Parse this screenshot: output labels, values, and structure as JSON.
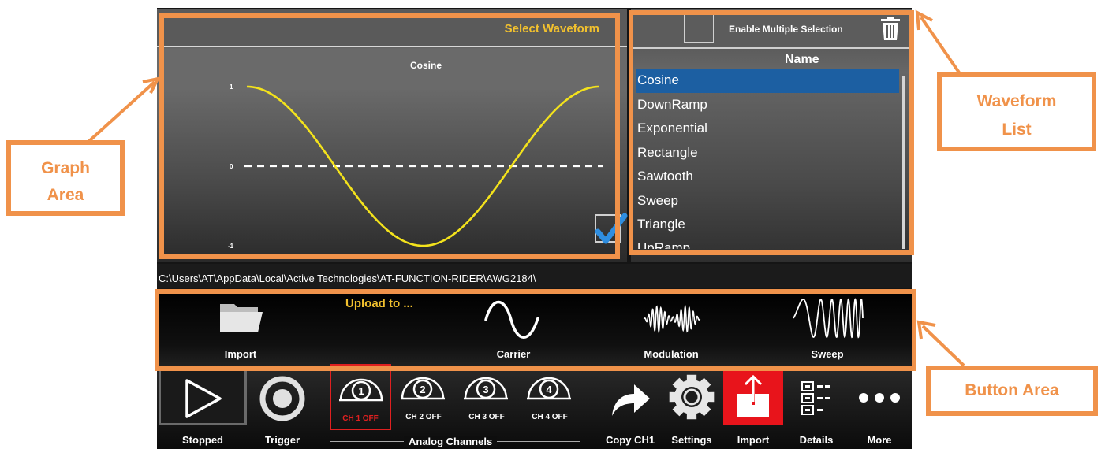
{
  "graph": {
    "header": "Select Waveform",
    "title": "Cosine",
    "y_ticks": [
      "1",
      "0",
      "-1"
    ]
  },
  "waveform_list": {
    "multi_select_label": "Enable Multiple Selection",
    "column_header": "Name",
    "items": [
      "Cosine",
      "DownRamp",
      "Exponential",
      "Rectangle",
      "Sawtooth",
      "Sweep",
      "Triangle",
      "UpRamp"
    ],
    "selected_index": 0
  },
  "path_bar": {
    "path": "C:\\Users\\AT\\AppData\\Local\\Active Technologies\\AT-FUNCTION-RIDER\\AWG2184\\"
  },
  "button_area": {
    "upload_label": "Upload to ...",
    "import_label": "Import",
    "carrier_label": "Carrier",
    "modulation_label": "Modulation",
    "sweep_label": "Sweep"
  },
  "toolbar": {
    "stopped_label": "Stopped",
    "trigger_label": "Trigger",
    "analog_channels_label": "Analog Channels",
    "channels": [
      {
        "number": "1",
        "status": "CH 1 OFF",
        "active": true
      },
      {
        "number": "2",
        "status": "CH 2 OFF",
        "active": false
      },
      {
        "number": "3",
        "status": "CH 3 OFF",
        "active": false
      },
      {
        "number": "4",
        "status": "CH 4 OFF",
        "active": false
      }
    ],
    "copy_label": "Copy CH1",
    "settings_label": "Settings",
    "import_label": "Import",
    "details_label": "Details",
    "more_label": "More"
  },
  "annotations": {
    "graph_area": [
      "Graph",
      "Area"
    ],
    "waveform_list": [
      "Waveform",
      "List"
    ],
    "button_area": "Button Area"
  },
  "colors": {
    "accent_orange": "#f0924a",
    "header_yellow": "#f2c12e",
    "waveform_yellow": "#f3e21c",
    "selection_blue": "#1c5fa2",
    "channel_active_red": "#e02020",
    "import_red": "#e8141b"
  }
}
